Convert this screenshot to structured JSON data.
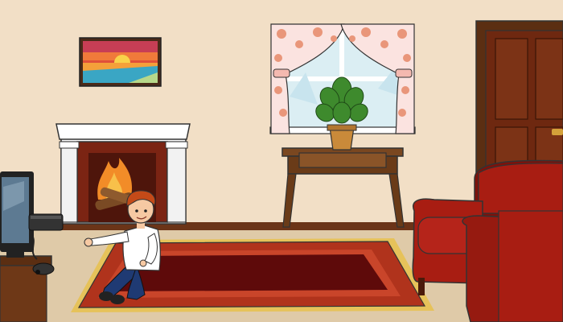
{
  "scene": {
    "name": "living-room",
    "objects": [
      "sunset-painting",
      "fireplace",
      "fire",
      "window",
      "curtains",
      "potted-plant",
      "console-table",
      "door",
      "red-sofa",
      "red-rug",
      "television",
      "game-console",
      "game-controller",
      "tv-stand",
      "boy"
    ]
  },
  "colors": {
    "wall": "#f2dfc6",
    "floor": "#dfcaa8",
    "baseboard": "#6b3418",
    "wood": "#7a4720",
    "wood_dark": "#5b2e12",
    "door": "#6e2810",
    "sofa": "#a81d12",
    "sofa_dark": "#7d120b",
    "rug_outer": "#b0331c",
    "rug_inner": "#5e0a0a",
    "fringe": "#e6c25a",
    "fireplace_white": "#ffffff",
    "fireplace_brick": "#7b2413",
    "flame": "#f28c28",
    "curtain": "#fbe3e0",
    "curtain_flower": "#e9967a",
    "window_glass": "#dbeef3",
    "plant": "#3e8a2d",
    "pot": "#c98a3a",
    "tv_screen": "#5d7a92",
    "shirt": "#ffffff",
    "jeans": "#1f3a73",
    "hair": "#c44a18",
    "skin": "#f6c9a3"
  }
}
